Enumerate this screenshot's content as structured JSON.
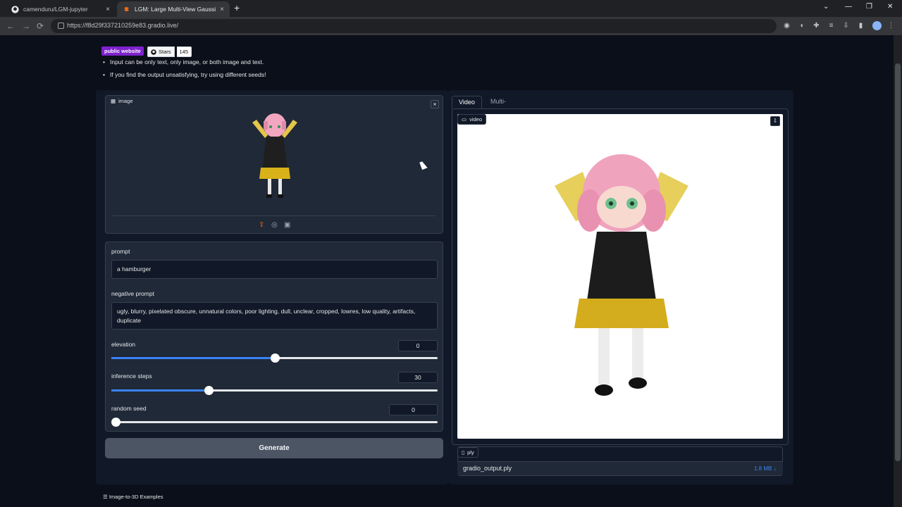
{
  "browser": {
    "tabs": [
      {
        "label": "camenduru/LGM-jupyter",
        "icon": "github-icon"
      },
      {
        "label": "LGM: Large Multi-View Gaussian...",
        "icon": "gradio-icon"
      }
    ],
    "new_tab": "+",
    "close_glyph": "×",
    "url": "https://f8d29f337210259e83.gradio.live/",
    "window_controls": [
      "⌄",
      "—",
      "❐",
      "✕"
    ]
  },
  "header": {
    "badge_public": "public website",
    "badge_stars_label": "Stars",
    "badge_stars_count": "145",
    "bullets": [
      "Input can be only text, only image, or both image and text.",
      "If you find the output unsatisfying, try using different seeds!"
    ]
  },
  "image_input": {
    "label": "image",
    "close": "×"
  },
  "prompt": {
    "label": "prompt",
    "value": "a hamburger"
  },
  "negative_prompt": {
    "label": "negative prompt",
    "value": "ugly, blurry, pixelated obscure, unnatural colors, poor lighting, dull, unclear, cropped, lowres, low quality, artifacts, duplicate"
  },
  "elevation": {
    "label": "elevation",
    "value": "0",
    "fraction": 0.5
  },
  "inference_steps": {
    "label": "inference steps",
    "value": "30",
    "fraction": 0.298
  },
  "random_seed": {
    "label": "random seed",
    "value": "0",
    "fraction": 0.0
  },
  "generate_label": "Generate",
  "output_tabs": [
    "Video",
    "Multi-view Image"
  ],
  "video": {
    "label": "video",
    "download": "⇩"
  },
  "file": {
    "label": "ply",
    "name": "gradio_output.ply",
    "size": "1.8 MB ↓"
  },
  "examples_label": "Image-to-3D Examples",
  "colors": {
    "accent": "#3b82f6",
    "badge": "#7e22ce",
    "upload_orange": "#f97316"
  }
}
